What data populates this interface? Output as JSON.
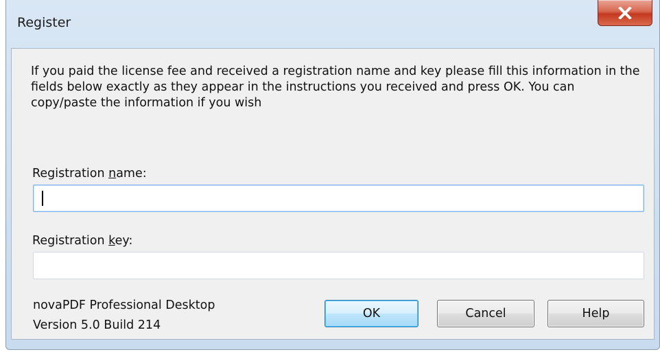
{
  "window": {
    "title": "Register",
    "close_icon": "close-x-icon"
  },
  "content": {
    "instructions": "If you paid the license fee and received a registration name and key please fill this information in the fields below exactly as they appear in the instructions you received and press OK. You can copy/paste the information if you wish"
  },
  "fields": {
    "name": {
      "label_before": "Registration ",
      "label_mnemonic": "n",
      "label_after": "ame:",
      "value": "",
      "placeholder": ""
    },
    "key": {
      "label_before": "Registration ",
      "label_mnemonic": "k",
      "label_after": "ey:",
      "value": "",
      "placeholder": ""
    }
  },
  "product": {
    "name": "novaPDF Professional Desktop",
    "version": "Version 5.0 Build 214"
  },
  "buttons": {
    "ok": "OK",
    "cancel": "Cancel",
    "help": "Help"
  },
  "colors": {
    "close_button": "#c4391f",
    "focus_border": "#7eb4ea",
    "default_button_border": "#3c7fb1"
  }
}
